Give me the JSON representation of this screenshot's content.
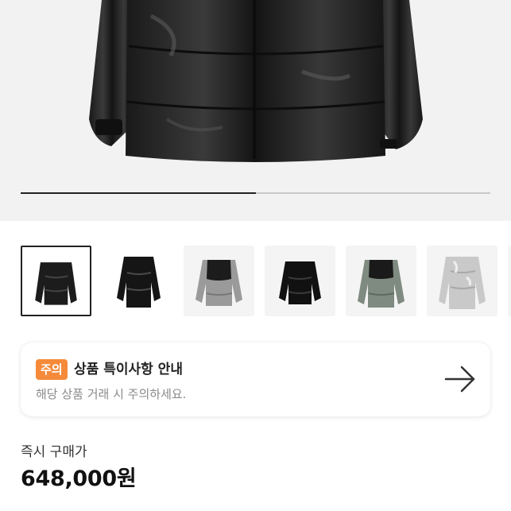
{
  "hero": {
    "image_subject": "black glossy puffer down jacket",
    "gallery_progress_fraction": 0.5
  },
  "thumbnails": [
    {
      "subject": "black glossy puffer jacket",
      "selected": true
    },
    {
      "subject": "black glossy puffer jacket",
      "selected": false
    },
    {
      "subject": "grey and black puffer jacket",
      "selected": false
    },
    {
      "subject": "black puffer jacket",
      "selected": false
    },
    {
      "subject": "grey-green and black puffer jacket",
      "selected": false
    },
    {
      "subject": "silver puffer jacket",
      "selected": false
    }
  ],
  "notice": {
    "badge": "주의",
    "title": "상품 특이사항 안내",
    "subtitle": "해당 상품 거래 시 주의하세요.",
    "arrow_icon": "arrow-right-icon"
  },
  "price": {
    "label": "즉시 구매가",
    "value": "648,000원"
  },
  "colors": {
    "badge": "#f58a3a",
    "hero_background": "#f2f2f2",
    "progress_fill": "#222222",
    "progress_track": "#c9c9c9"
  }
}
